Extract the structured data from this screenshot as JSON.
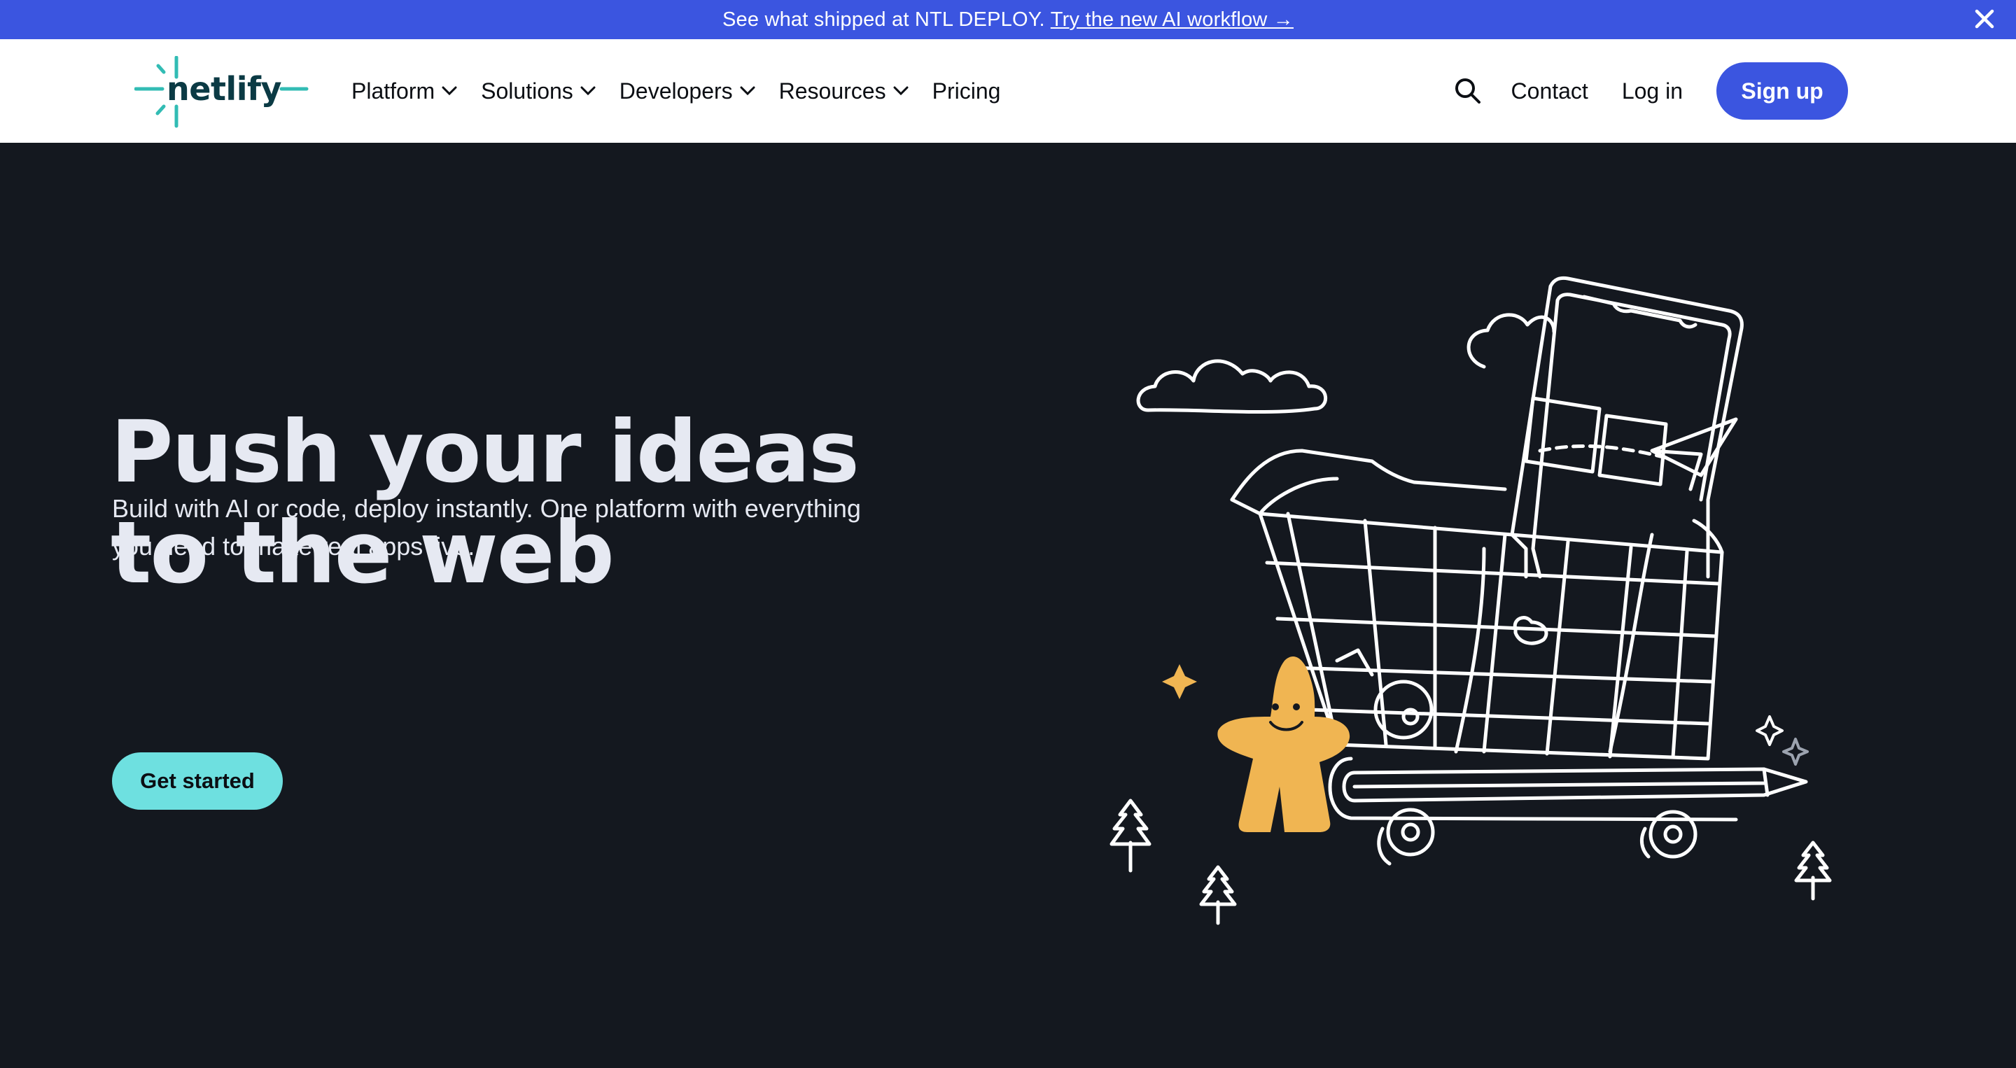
{
  "banner": {
    "text": "See what shipped at NTL DEPLOY.",
    "link": "Try the new AI workflow →",
    "close_icon": "close-icon",
    "background": "#3b55e0"
  },
  "header": {
    "logo_text": "netlify",
    "nav": [
      {
        "label": "Platform",
        "has_dropdown": true
      },
      {
        "label": "Solutions",
        "has_dropdown": true
      },
      {
        "label": "Developers",
        "has_dropdown": true
      },
      {
        "label": "Resources",
        "has_dropdown": true
      },
      {
        "label": "Pricing",
        "has_dropdown": false
      }
    ],
    "search_icon": "search-icon",
    "contact": "Contact",
    "login": "Log in",
    "signup": "Sign up"
  },
  "hero": {
    "title_line1": "Push your ideas",
    "title_line2": "to the web",
    "subtitle_line1": "Build with AI or code, deploy instantly. One platform with everything",
    "subtitle_line2": "you need to make real apps live.",
    "cta": "Get started",
    "illustration": "shopping-cart-illustration"
  },
  "colors": {
    "accent": "#3b55e0",
    "cta": "#6ee0e0",
    "hero_bg": "#14181f",
    "logo_teal": "#32bcb4",
    "logo_dark": "#0b3a44",
    "star_yellow": "#f0b552"
  }
}
